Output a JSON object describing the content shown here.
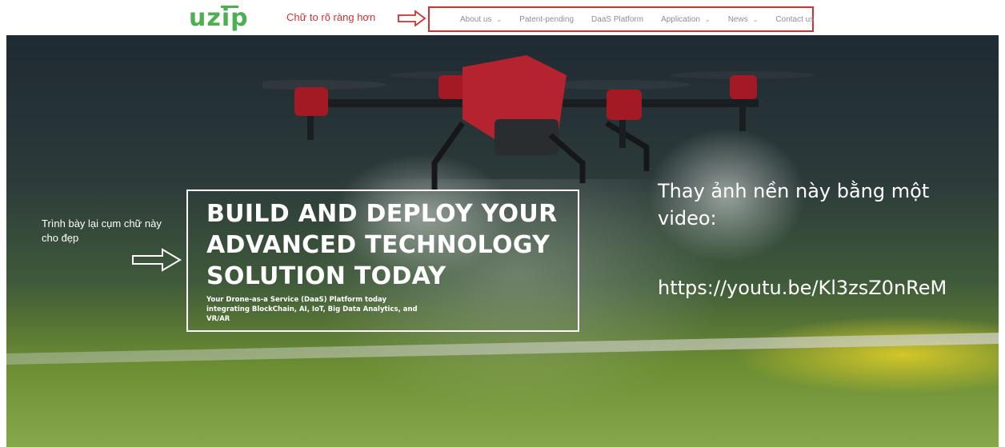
{
  "brand": {
    "logo_text": "uzip",
    "logo_color": "#4caf50"
  },
  "annotations": {
    "top_note": "Chữ to rõ ràng hơn",
    "left_note": "Trình bày lại cụm chữ này cho đẹp",
    "right_note": "Thay ảnh nền này bằng một video:",
    "video_url": "https://youtu.be/Kl3zsZ0nReM",
    "note_color": "#d32f2f"
  },
  "nav": {
    "items": [
      {
        "label": "About us",
        "dropdown": true
      },
      {
        "label": "Patent-pending",
        "dropdown": false
      },
      {
        "label": "DaaS Platform",
        "dropdown": false
      },
      {
        "label": "Application",
        "dropdown": true
      },
      {
        "label": "News",
        "dropdown": true
      },
      {
        "label": "Contact us",
        "dropdown": false
      }
    ]
  },
  "hero": {
    "title": "BUILD AND DEPLOY YOUR ADVANCED TECHNOLOGY SOLUTION TODAY",
    "subtitle": "Your Drone-as-a Service (DaaS) Platform today integrating BlockChain, AI, IoT, Big Data Analytics, and VR/AR"
  }
}
